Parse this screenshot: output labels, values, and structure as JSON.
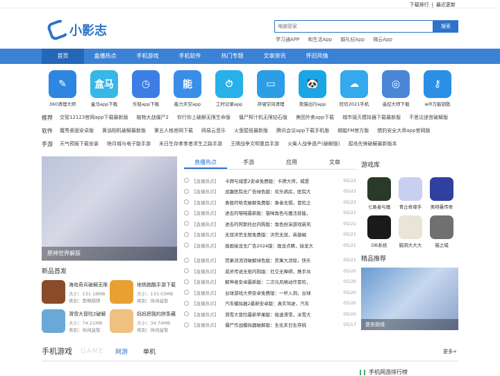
{
  "top": {
    "links": [
      "下载排行",
      "|",
      "最近更新"
    ]
  },
  "logo": {
    "text": "小影志"
  },
  "search": {
    "placeholder": "电脑管家",
    "button": "搜索"
  },
  "hot": [
    "学习通APP",
    "和生活App",
    "婚礼纪App",
    "微云App"
  ],
  "nav": [
    "首页",
    "盒播热点",
    "手机游戏",
    "手机软件",
    "热门专题",
    "文章资讯",
    "怀旧风情"
  ],
  "apps": [
    {
      "name": "360清理大师",
      "color": "#2f86e0",
      "glyph": "✎"
    },
    {
      "name": "盒马app下载",
      "color": "#37b6e8",
      "glyph": "盒马"
    },
    {
      "name": "乐轻app下载",
      "color": "#3d7ee6",
      "glyph": "◷"
    },
    {
      "name": "能力天空app",
      "color": "#3a8ee8",
      "glyph": "能"
    },
    {
      "name": "工时记录app",
      "color": "#27b1e8",
      "glyph": "⏱"
    },
    {
      "name": "存储空间清理",
      "color": "#2c9ee6",
      "glyph": "▭"
    },
    {
      "name": "熊猫出行app",
      "color": "#1aa5e6",
      "glyph": "🐼"
    },
    {
      "name": "旺信2021手机",
      "color": "#35a9ee",
      "glyph": "☁"
    },
    {
      "name": "遥控大师下载",
      "color": "#4a86d8",
      "glyph": "◎"
    },
    {
      "name": "wifi万能钥匙",
      "color": "#2b8fe6",
      "glyph": "⚷"
    }
  ],
  "tags": [
    {
      "label": "推荐",
      "items": [
        "交管12123官网app下载最新版",
        "植物大战僵尸2",
        "你行你上破解无限生命版",
        "僵尸榨汁机无限钻石版",
        "美团外卖app下载",
        "城市毁灭模拟器下载最新版",
        "不思议迷宫破解版"
      ]
    },
    {
      "label": "软件",
      "items": [
        "魔秀桌面安卓版",
        "黄油相机破解最新版",
        "第五人格官网下载",
        "网易云音乐",
        "火萤壁纸最新版",
        "腾讯会议app下载手机版",
        "蜻蜓FM官方版",
        "猎豹安全大师app官网版"
      ]
    },
    {
      "label": "手游",
      "items": [
        "天气预报下载安装",
        "映月城与电子能手游",
        "末日生存孝孝者求生之路手游",
        "王牌战争文明重启手游",
        "火柴人战争遗产(破解版)",
        "孤岛先锋破解最新版本"
      ]
    }
  ],
  "banner": {
    "caption": "原神世界解版"
  },
  "newgames": {
    "title": "新品首发",
    "items": [
      {
        "name": "海岛奇兵破解无限",
        "size": "大小：131.18MB",
        "type": "类别：策略棋牌",
        "color": "#8a4b2a"
      },
      {
        "name": "地铁跑酷手游下载",
        "size": "大小：133.03MB",
        "type": "类别：休闲益智",
        "color": "#e8a030"
      },
      {
        "name": "滑雪大冒险2破解",
        "size": "大小：74.21MB",
        "type": "类别：休闲益智",
        "color": "#6aa8d8"
      },
      {
        "name": "妈妈把我的拼条藏",
        "size": "大小：34.74MB",
        "type": "类别：休闲益智",
        "color": "#f0c080"
      }
    ]
  },
  "news": {
    "tabs": [
      "直播热点",
      "手游",
      "应用",
      "文章"
    ],
    "rows": [
      {
        "cat": "【直播热点】",
        "title": "卡牌与城堡2安卓免费版：卡牌大师，城堡",
        "date": "05/22"
      },
      {
        "cat": "【直播热点】",
        "title": "逗趣医院无广告绿色版：欢乐病房，医院大",
        "date": "05/22"
      },
      {
        "cat": "【直播热点】",
        "title": "勇般的哈克破解免费版：勇者无惧，冒险之",
        "date": "05/22"
      },
      {
        "cat": "【直播热点】",
        "title": "进击的喵喵最新版：猫咪角色与魔法技能，",
        "date": "05/21"
      },
      {
        "cat": "【直播热点】",
        "title": "进击的阿斯托拉内购版：角色扮演游戏新风",
        "date": "05/21"
      },
      {
        "cat": "【直播热点】",
        "title": "无双洪荒无限免费版：洪荒无双，英雄崛",
        "date": "05/21"
      },
      {
        "cat": "【直播热点】",
        "title": "画画接龙无广告2024版：画龙点睛，接龙大",
        "date": "05/21"
      },
      {
        "cat": "【直播热点】",
        "title": "宾果消消消破解绿色版：宾果大消除，快乐",
        "date": "05/21"
      },
      {
        "cat": "【直播热点】",
        "title": "戒灵传说无限内购版：社交无障碍，携手共",
        "date": "05/20"
      },
      {
        "cat": "【直播热点】",
        "title": "解神者安卓最新版：二次元风格动作冒险，",
        "date": "05/20"
      },
      {
        "cat": "【直播热点】",
        "title": "台球游戏大师安卓免费版：一杆入洞，台球",
        "date": "05/20"
      },
      {
        "cat": "【直播热点】",
        "title": "汽车模拟器2最新安卓版：真实驾驶，汽车",
        "date": "05/20"
      },
      {
        "cat": "【直播热点】",
        "title": "滑雪大冒险最新苹果版：极速滑雪，冰雪大",
        "date": "05/20"
      },
      {
        "cat": "【直播热点】",
        "title": "僵尸作战模拟器破解版：生化末日生存挑",
        "date": "05/17"
      }
    ]
  },
  "gamelib": {
    "title": "游戏库",
    "items": [
      {
        "name": "七勇者与魔",
        "color": "#2a3a2a"
      },
      {
        "name": "青丘奇缘手",
        "color": "#c8d0f0"
      },
      {
        "name": "奥特曼传奇",
        "color": "#3040a0"
      },
      {
        "name": "DB系统",
        "color": "#1a1a1a"
      },
      {
        "name": "脑洞大大大",
        "color": "#e8e4d8"
      },
      {
        "name": "猫之城",
        "color": "#707070"
      }
    ]
  },
  "featured": {
    "title": "精品推荐",
    "caption": "堡垒前线"
  },
  "bottom": {
    "title": "手机游戏",
    "en": "GAME",
    "tabs": [
      "网游",
      "单机"
    ],
    "more": "更多+"
  },
  "rank": {
    "title": "手机网游排行榜"
  }
}
